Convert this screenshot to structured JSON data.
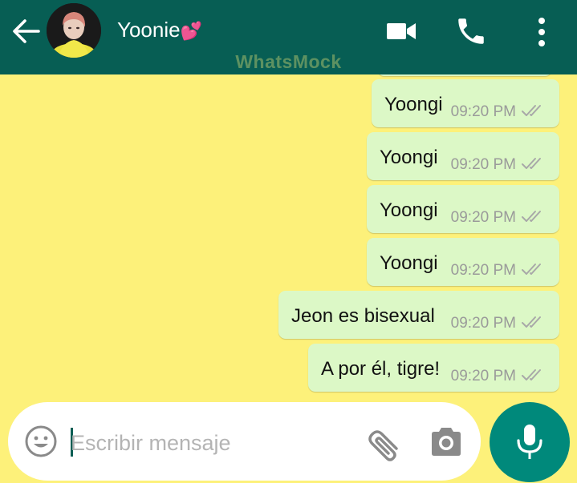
{
  "header": {
    "contact_name": "Yoonie",
    "contact_emoji": "💕",
    "watermark": "WhatsMock",
    "back_icon": "back-arrow-icon",
    "video_icon": "video-camera-icon",
    "call_icon": "phone-icon",
    "menu_icon": "more-vertical-icon",
    "bg_color": "#075e54"
  },
  "chat": {
    "background": "#fdf17a",
    "bubble_color": "#dcf8c6",
    "messages": [
      {
        "text": "Yoongi",
        "time": "09:20 PM",
        "status": "double-tick"
      },
      {
        "text": "Yoongi",
        "time": "09:20 PM",
        "status": "double-tick"
      },
      {
        "text": "Yoongi",
        "time": "09:20 PM",
        "status": "double-tick"
      },
      {
        "text": "Yoongi",
        "time": "09:20 PM",
        "status": "double-tick"
      },
      {
        "text": "Jeon es bisexual",
        "time": "09:20 PM",
        "status": "double-tick"
      },
      {
        "text": "A por él, tigre!",
        "time": "09:20 PM",
        "status": "double-tick"
      }
    ]
  },
  "input": {
    "placeholder": "Escribir mensaje",
    "value": "",
    "emoji_icon": "emoji-icon",
    "attach_icon": "paperclip-icon",
    "camera_icon": "camera-icon",
    "mic_icon": "microphone-icon",
    "mic_color": "#00897b"
  }
}
